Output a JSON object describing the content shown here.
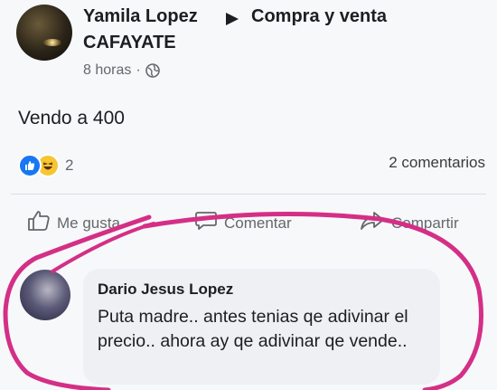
{
  "post": {
    "author": "Yamila Lopez",
    "group_line1": "Compra y venta",
    "group_line2": "CAFAYATE",
    "time": "8 horas",
    "meta_dot": "·",
    "text": "Vendo a 400",
    "reaction_count": "2",
    "comments_count": "2 comentarios",
    "icons": [
      "arrow-right-icon",
      "globe-icon",
      "like-reaction-icon",
      "haha-reaction-icon",
      "thumbs-up-icon",
      "comment-icon",
      "share-icon"
    ]
  },
  "actions": {
    "like": "Me gusta",
    "comment": "Comentar",
    "share": "Compartir"
  },
  "comment": {
    "author": "Dario Jesus Lopez",
    "text": "Puta madre.. antes tenias qe adivinar el precio.. ahora ay qe adivinar qe vende.."
  },
  "colors": {
    "like_blue": "#1877f2",
    "haha_yellow": "#f7c531",
    "highlight_circle": "#d42f86",
    "comment_bubble": "#eef0f4"
  }
}
